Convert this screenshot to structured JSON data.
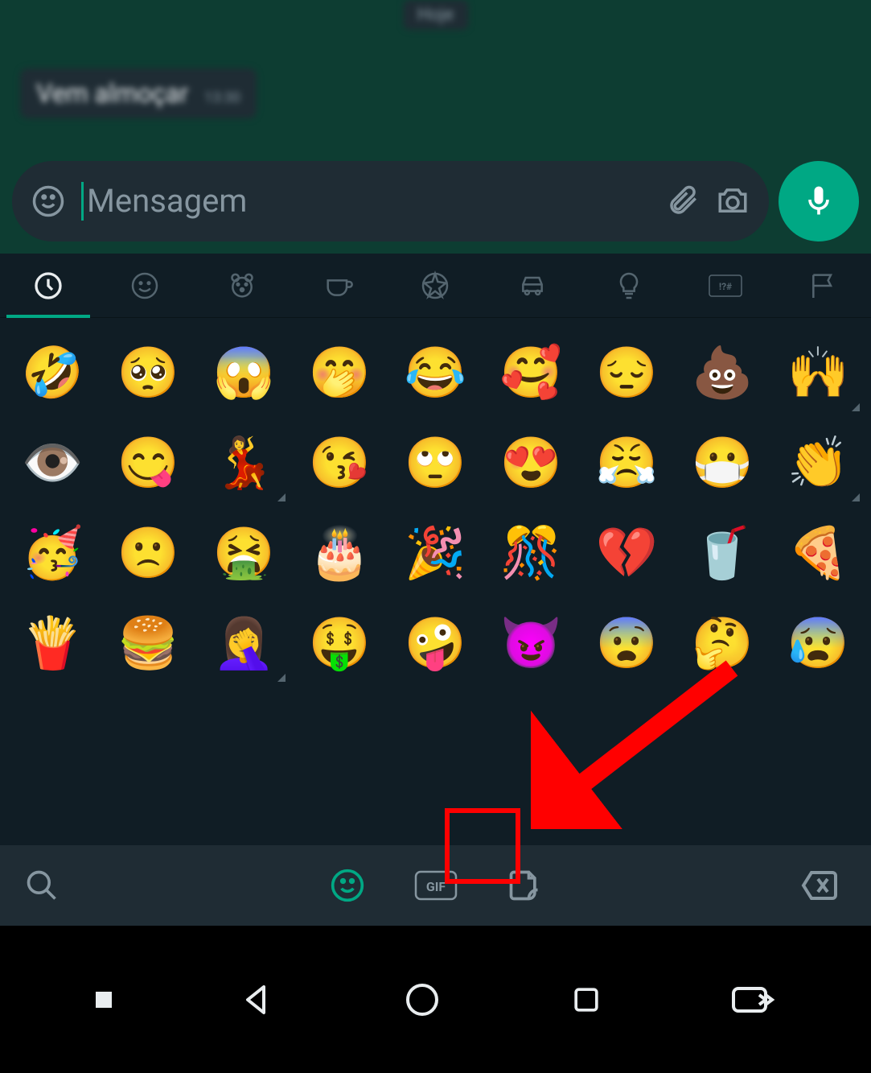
{
  "chat": {
    "date_label": "Hoje",
    "message_text": "Vem almoçar",
    "message_time": "13:30"
  },
  "input": {
    "placeholder": "Mensagem"
  },
  "categories": [
    {
      "name": "recent",
      "active": true
    },
    {
      "name": "smileys",
      "active": false
    },
    {
      "name": "animals",
      "active": false
    },
    {
      "name": "food",
      "active": false
    },
    {
      "name": "activity",
      "active": false
    },
    {
      "name": "travel",
      "active": false
    },
    {
      "name": "objects",
      "active": false
    },
    {
      "name": "symbols",
      "active": false
    },
    {
      "name": "flags",
      "active": false
    }
  ],
  "emojis": [
    {
      "glyph": "🤣",
      "variant": false
    },
    {
      "glyph": "🥺",
      "variant": false
    },
    {
      "glyph": "😱",
      "variant": false
    },
    {
      "glyph": "🤭",
      "variant": false
    },
    {
      "glyph": "😂",
      "variant": false
    },
    {
      "glyph": "🥰",
      "variant": false
    },
    {
      "glyph": "😔",
      "variant": false
    },
    {
      "glyph": "💩",
      "variant": false
    },
    {
      "glyph": "🙌",
      "variant": true
    },
    {
      "glyph": "👁️",
      "variant": false
    },
    {
      "glyph": "😋",
      "variant": false
    },
    {
      "glyph": "💃",
      "variant": true
    },
    {
      "glyph": "😘",
      "variant": false
    },
    {
      "glyph": "🙄",
      "variant": false
    },
    {
      "glyph": "😍",
      "variant": false
    },
    {
      "glyph": "😤",
      "variant": false
    },
    {
      "glyph": "😷",
      "variant": false
    },
    {
      "glyph": "👏",
      "variant": true
    },
    {
      "glyph": "🥳",
      "variant": false
    },
    {
      "glyph": "🙁",
      "variant": false
    },
    {
      "glyph": "🤮",
      "variant": false
    },
    {
      "glyph": "🎂",
      "variant": false
    },
    {
      "glyph": "🎉",
      "variant": false
    },
    {
      "glyph": "🎊",
      "variant": false
    },
    {
      "glyph": "💔",
      "variant": false
    },
    {
      "glyph": "🥤",
      "variant": false
    },
    {
      "glyph": "🍕",
      "variant": false
    },
    {
      "glyph": "🍟",
      "variant": false
    },
    {
      "glyph": "🍔",
      "variant": false
    },
    {
      "glyph": "🤦‍♀️",
      "variant": true
    },
    {
      "glyph": "🤑",
      "variant": false
    },
    {
      "glyph": "🤪",
      "variant": false
    },
    {
      "glyph": "😈",
      "variant": false
    },
    {
      "glyph": "😨",
      "variant": false
    },
    {
      "glyph": "🤔",
      "variant": false
    },
    {
      "glyph": "😰",
      "variant": false
    }
  ],
  "bottom_tabs": {
    "emoji_active": true,
    "gif_label": "GIF"
  },
  "colors": {
    "accent": "#00a884",
    "panel": "#101d25",
    "pill": "#1f2c34",
    "highlight": "#ff0000"
  }
}
